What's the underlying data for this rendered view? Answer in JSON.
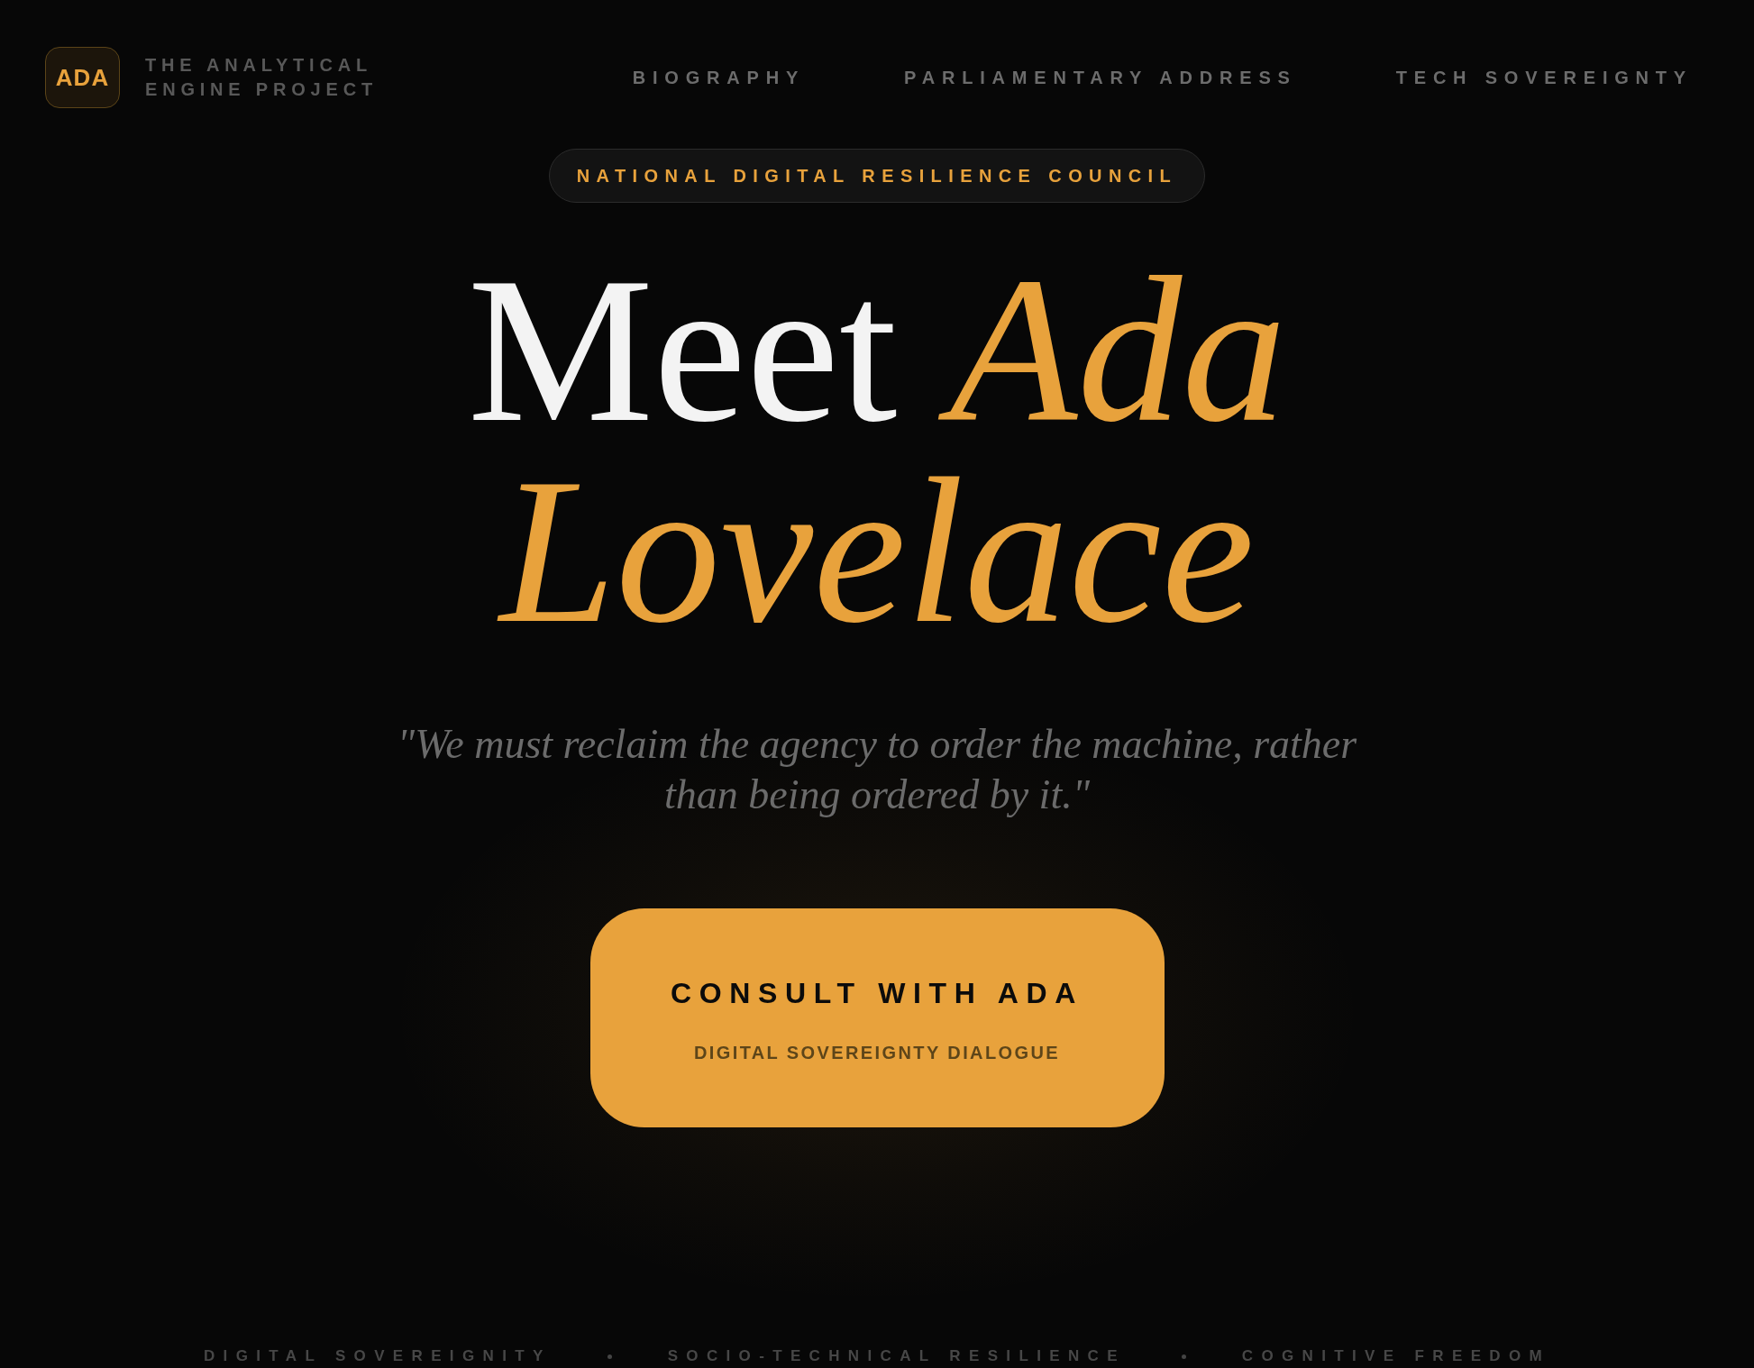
{
  "header": {
    "logo": "ADA",
    "brand": "THE ANALYTICAL ENGINE PROJECT",
    "nav": [
      {
        "label": "BIOGRAPHY"
      },
      {
        "label": "PARLIAMENTARY ADDRESS"
      },
      {
        "label": "TECH SOVEREIGNTY"
      }
    ]
  },
  "badge": "NATIONAL DIGITAL RESILIENCE COUNCIL",
  "heading": "Meet *Ada Lovelace*",
  "quote": "\"We must reclaim the agency to order the machine, rather than being ordered by it.\"",
  "cta": {
    "title": "CONSULT WITH ADA",
    "subtitle": "DIGITAL SOVEREIGNTY DIALOGUE"
  },
  "ticker": [
    "DIGITAL SOVEREIGNITY",
    "SOCIO-TECHNICAL RESILIENCE",
    "COGNITIVE FREEDOM"
  ]
}
